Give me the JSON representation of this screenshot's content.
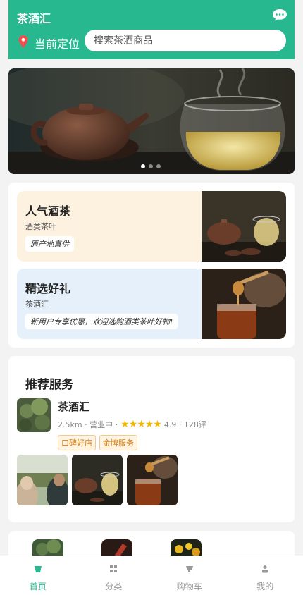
{
  "header": {
    "title": "茶酒汇",
    "location_label": "当前定位",
    "search_placeholder": "搜索茶酒商品",
    "accent_color": "#27b890"
  },
  "banner": {
    "slides": 3,
    "active_index": 0
  },
  "categories": [
    {
      "title": "人气酒茶",
      "subtitle": "酒类茶叶",
      "tag": "原产地直供"
    },
    {
      "title": "精选好礼",
      "subtitle": "茶酒汇",
      "tag": "新用户专享优惠，欢迎选购酒类茶叶好物!"
    }
  ],
  "recommend": {
    "heading": "推荐服务",
    "shop": {
      "name": "茶酒汇",
      "distance": "2.5km",
      "status": "营业中",
      "rating": "4.9",
      "reviews": "128评",
      "badges": [
        "口碑好店",
        "金牌服务"
      ]
    }
  },
  "tabbar": {
    "items": [
      {
        "label": "首页",
        "icon": "home-icon",
        "active": true
      },
      {
        "label": "分类",
        "icon": "grid-icon",
        "active": false
      },
      {
        "label": "购物车",
        "icon": "cart-icon",
        "active": false
      },
      {
        "label": "我的",
        "icon": "user-icon",
        "active": false
      }
    ]
  }
}
